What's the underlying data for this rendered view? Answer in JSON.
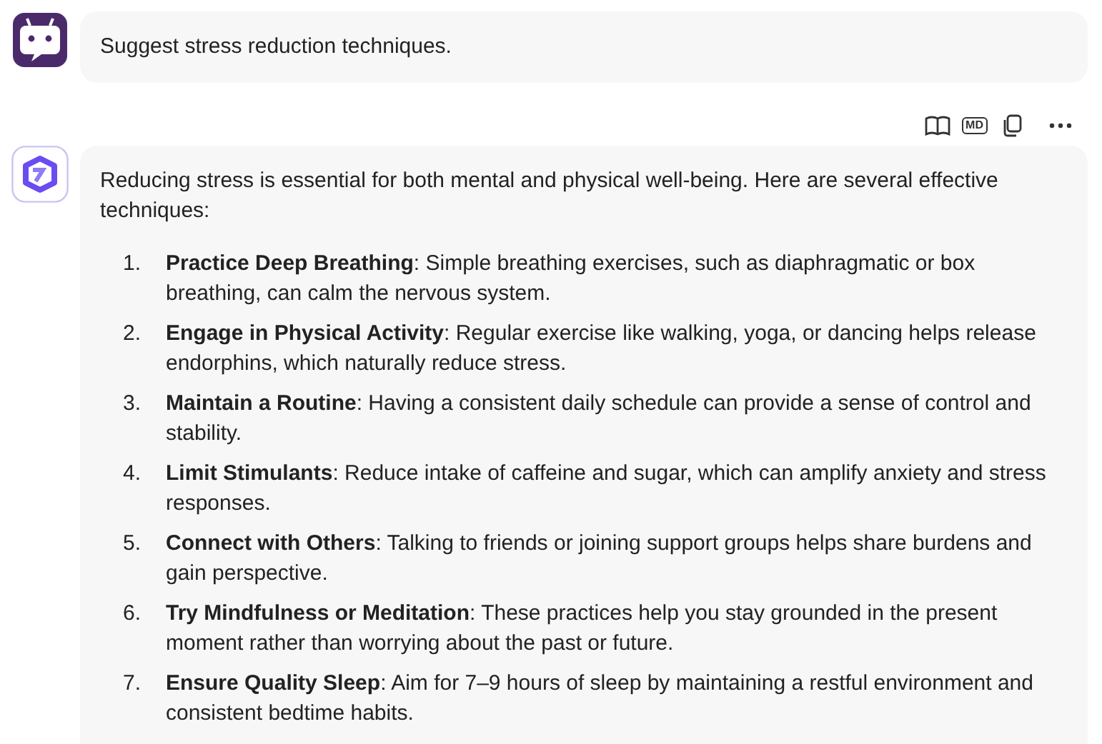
{
  "user_message": {
    "text": "Suggest stress reduction techniques."
  },
  "toolbar": {
    "markdown_label": "MD"
  },
  "assistant_message": {
    "intro": "Reducing stress is essential for both mental and physical well-being. Here are several effective techniques:",
    "items": [
      {
        "number": "1.",
        "text": "**Practice Deep Breathing**: Simple breathing exercises, such as diaphragmatic or box breathing, can calm the nervous system."
      },
      {
        "number": "2.",
        "text": "**Engage in Physical Activity**: Regular exercise like walking, yoga, or dancing helps release endorphins, which naturally reduce stress."
      },
      {
        "number": "3.",
        "text": "**Maintain a Routine**: Having a consistent daily schedule can provide a sense of control and stability."
      },
      {
        "number": "4.",
        "text": "**Limit Stimulants**: Reduce intake of caffeine and sugar, which can amplify anxiety and stress responses."
      },
      {
        "number": "5.",
        "text": "**Connect with Others**: Talking to friends or joining support groups helps share burdens and gain perspective."
      },
      {
        "number": "6.",
        "text": "**Try Mindfulness or Meditation**: These practices help you stay grounded in the present moment rather than worrying about the past or future."
      },
      {
        "number": "7.",
        "text": "**Ensure Quality Sleep**: Aim for 7–9 hours of sleep by maintaining a restful environment and consistent bedtime habits."
      }
    ]
  }
}
